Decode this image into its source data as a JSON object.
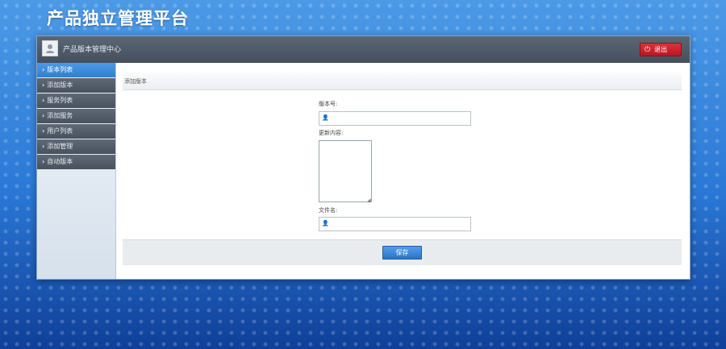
{
  "app": {
    "title": "产品独立管理平台"
  },
  "topbar": {
    "title": "产品版本管理中心",
    "logout_label": "退出",
    "logout_icon": "power-icon"
  },
  "sidebar": {
    "items": [
      {
        "label": "版本列表",
        "active": true
      },
      {
        "label": "添加版本",
        "active": false
      },
      {
        "label": "服务列表",
        "active": false
      },
      {
        "label": "添加服务",
        "active": false
      },
      {
        "label": "用户列表",
        "active": false
      },
      {
        "label": "添加管理",
        "active": false
      },
      {
        "label": "自动版本",
        "active": false
      }
    ]
  },
  "breadcrumb": {
    "text": "添加版本"
  },
  "form": {
    "version_label": "版本号:",
    "version_value": "",
    "update_label": "更新内容:",
    "update_value": "",
    "filename_label": "文件名:",
    "filename_value": "",
    "save_label": "保存"
  },
  "colors": {
    "accent": "#2f7fd0",
    "topbar": "#4f5a67",
    "danger": "#c8202a"
  }
}
